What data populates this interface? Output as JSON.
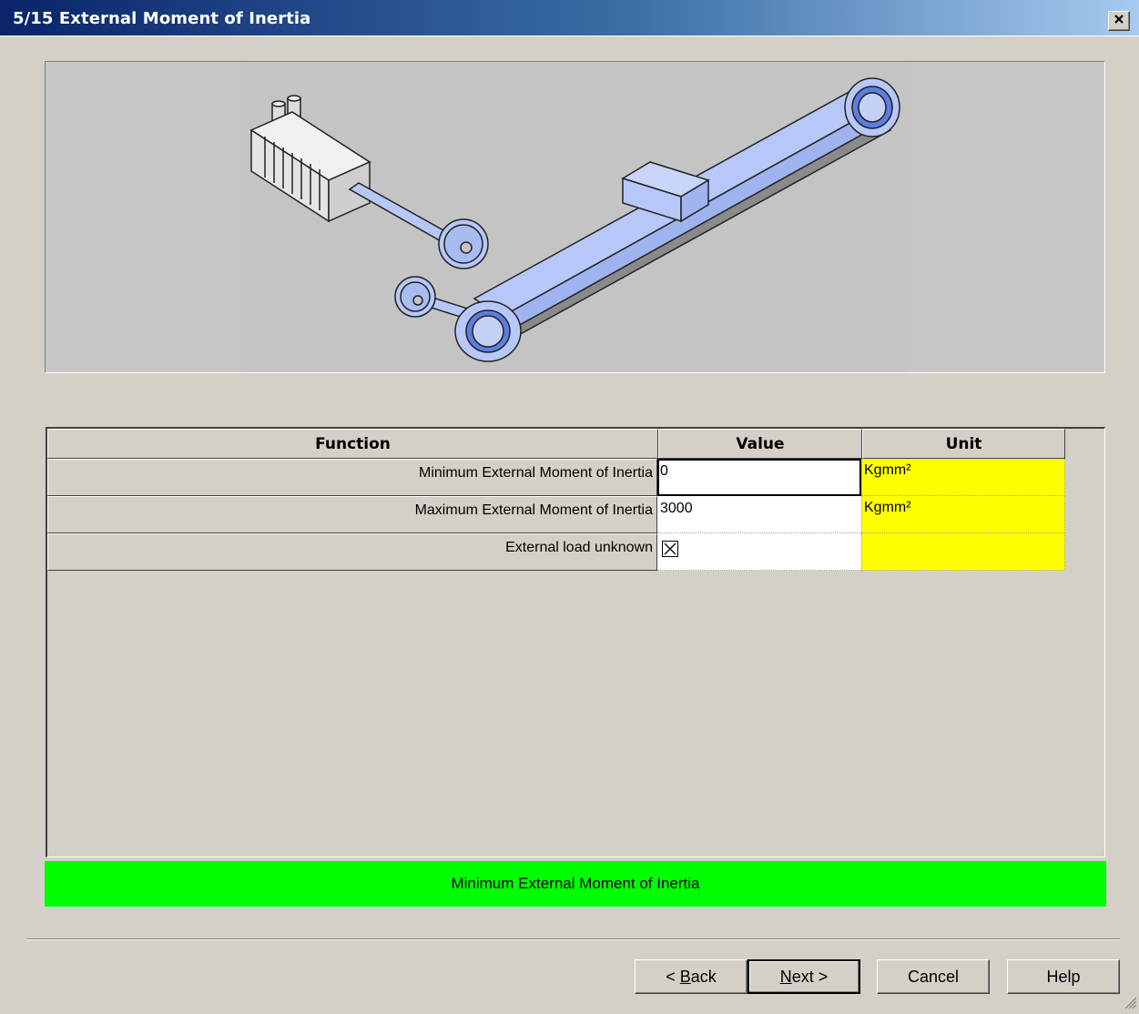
{
  "window": {
    "title": "5/15 External Moment of Inertia",
    "close_label": "✕"
  },
  "grid": {
    "headers": {
      "function": "Function",
      "value": "Value",
      "unit": "Unit"
    },
    "rows": [
      {
        "function": "Minimum External Moment of Inertia",
        "value": "0",
        "unit": "Kgmm²"
      },
      {
        "function": "Maximum External Moment of Inertia",
        "value": "3000",
        "unit": "Kgmm²"
      },
      {
        "function": "External load unknown",
        "value": "",
        "unit": "",
        "checked": true
      }
    ]
  },
  "status": {
    "text": "Minimum External Moment of Inertia",
    "color": "#00ff00"
  },
  "buttons": {
    "back": {
      "before": "< ",
      "mnemonic": "B",
      "after": "ack"
    },
    "next": {
      "mnemonic": "N",
      "after": "ext >"
    },
    "cancel": "Cancel",
    "help": "Help"
  },
  "colors": {
    "title_start": "#0a246a",
    "title_end": "#a6caf0",
    "unit_cell": "#ffff00",
    "part_fill": "#b7c8f8"
  },
  "icons": {
    "close": "close-icon",
    "checkbox": "x-checkbox-icon",
    "grip": "resize-grip-icon"
  }
}
